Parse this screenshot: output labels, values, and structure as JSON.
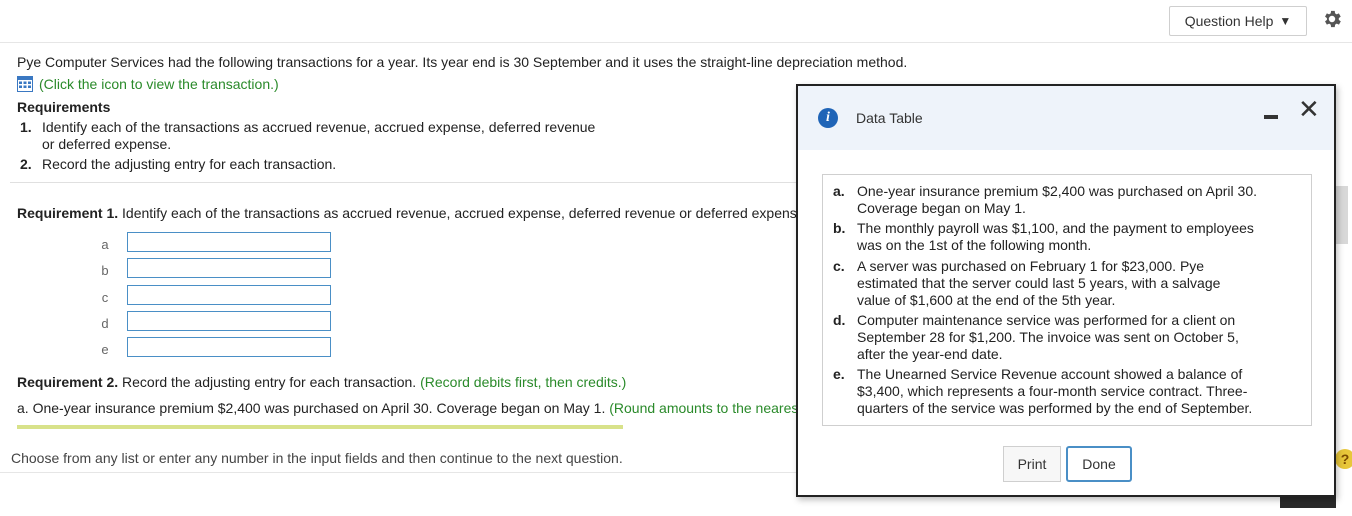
{
  "header": {
    "question_help_label": "Question Help",
    "caret": "▼",
    "gear_icon": "gear-icon"
  },
  "intro_text": "Pye Computer Services had the following transactions for a year. Its year end is 30 September and it uses the straight-line depreciation method.",
  "click_icon_text": "(Click the icon to view the transaction.)",
  "requirements": {
    "title": "Requirements",
    "items": [
      {
        "num": "1.",
        "line1": "Identify each of the transactions as accrued revenue, accrued expense, deferred revenue",
        "line2": "or deferred expense."
      },
      {
        "num": "2.",
        "line1": "Record the adjusting entry for each transaction.",
        "line2": ""
      }
    ]
  },
  "req1": {
    "bold": "Requirement 1.",
    "text": "Identify each of the transactions as accrued revenue, accrued expense, deferred revenue or deferred expense.",
    "rows": [
      {
        "label": "a",
        "value": ""
      },
      {
        "label": "b",
        "value": ""
      },
      {
        "label": "c",
        "value": ""
      },
      {
        "label": "d",
        "value": ""
      },
      {
        "label": "e",
        "value": ""
      }
    ]
  },
  "req2": {
    "bold": "Requirement 2.",
    "text": "Record the adjusting entry for each transaction.",
    "note": "(Record debits first, then credits.)",
    "a_text": "a. One-year insurance premium $2,400 was purchased on April 30. Coverage began on May 1.",
    "a_note": "(Round amounts to the nearest"
  },
  "footer": {
    "instruction": "Choose from any list or enter any number in the input fields and then continue to the next question.",
    "help_symbol": "?"
  },
  "modal": {
    "info_symbol": "i",
    "title": "Data Table",
    "close_symbol": "✕",
    "items": [
      {
        "letter": "a.",
        "text": "One-year insurance premium $2,400 was purchased on April 30. Coverage began on May 1."
      },
      {
        "letter": "b.",
        "text": "The monthly payroll was $1,100, and the payment to employees was on the 1st of the following month."
      },
      {
        "letter": "c.",
        "text": "A server was purchased on February 1 for $23,000. Pye estimated that the server could last 5 years, with a salvage value of $1,600 at the end of the 5th year."
      },
      {
        "letter": "d.",
        "text": "Computer maintenance service was performed for a client on September 28 for $1,200. The invoice was sent on October 5, after the year-end date."
      },
      {
        "letter": "e.",
        "text": "The Unearned Service Revenue account showed a balance of $3,400, which represents a four-month service contract. Three-quarters of the service was performed by the end of September."
      }
    ],
    "print_label": "Print",
    "done_label": "Done"
  }
}
